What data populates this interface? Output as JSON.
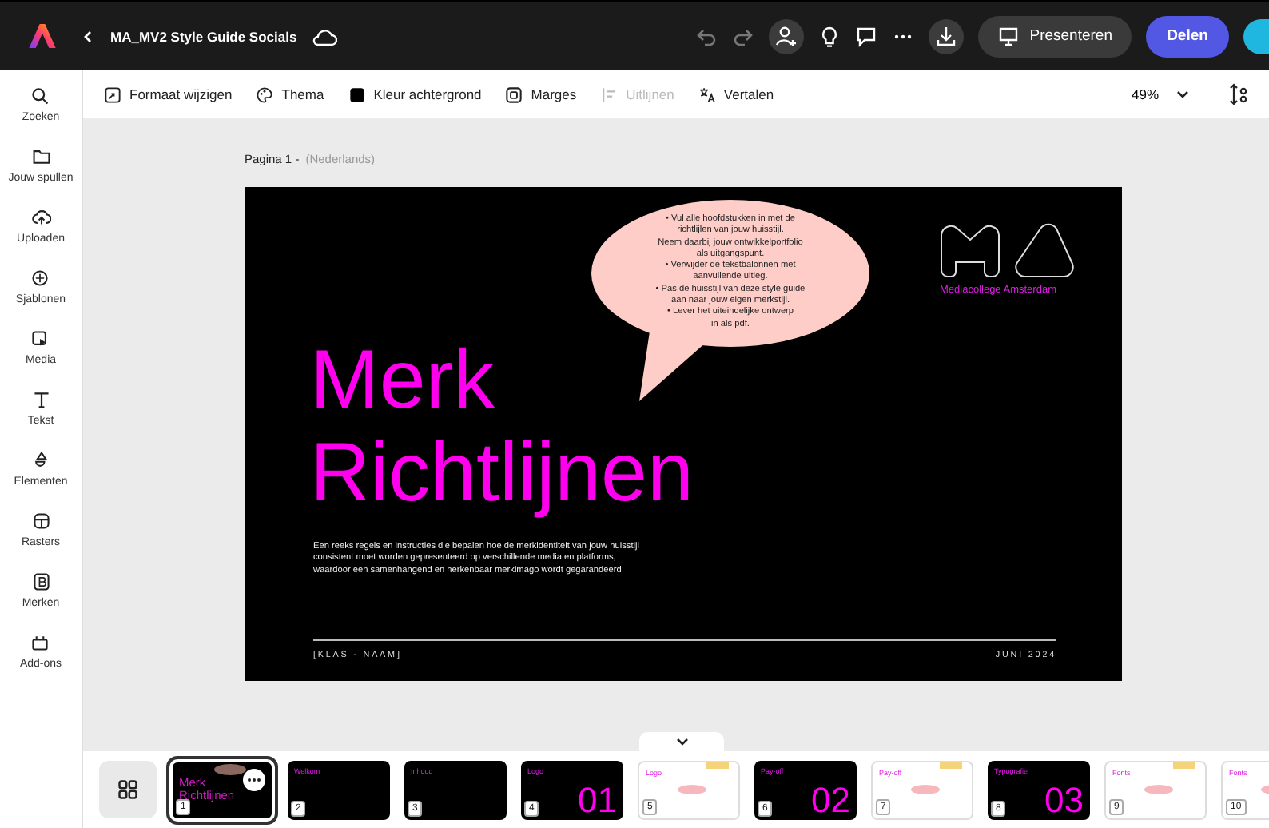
{
  "topbar": {
    "title": "MA_MV2 Style Guide Socials",
    "present_button": "Presenteren",
    "share_button": "Delen"
  },
  "toolbar": {
    "items": [
      {
        "label": "Formaat wijzigen",
        "kind": "resize",
        "disabled": false
      },
      {
        "label": "Thema",
        "kind": "palette",
        "disabled": false
      },
      {
        "label": "Kleur achtergrond",
        "kind": "swatch",
        "disabled": false
      },
      {
        "label": "Marges",
        "kind": "margins",
        "disabled": false
      },
      {
        "label": "Uitlijnen",
        "kind": "align",
        "disabled": true
      },
      {
        "label": "Vertalen",
        "kind": "translate",
        "disabled": false
      }
    ],
    "zoom": "49%"
  },
  "sidebar": {
    "items": [
      {
        "label": "Zoeken",
        "kind": "search"
      },
      {
        "label": "Jouw spullen",
        "kind": "folder"
      },
      {
        "label": "Uploaden",
        "kind": "upload"
      },
      {
        "label": "Sjablonen",
        "kind": "templates"
      },
      {
        "label": "Media",
        "kind": "media"
      },
      {
        "label": "Tekst",
        "kind": "text"
      },
      {
        "label": "Elementen",
        "kind": "shapes"
      },
      {
        "label": "Rasters",
        "kind": "grid"
      },
      {
        "label": "Merken",
        "kind": "brand"
      },
      {
        "label": "Add-ons",
        "kind": "addons"
      }
    ]
  },
  "page": {
    "label": "Pagina 1 -",
    "language": "(Nederlands)"
  },
  "slide": {
    "title_lines": [
      "Merk",
      "Richtlijnen"
    ],
    "bubble_text": "• Vul alle hoofdstukken in met de\nrichtlijlen van jouw huisstijl.\nNeem daarbij jouw ontwikkelportfolio\nals uitgangspunt.\n• Verwijder de tekstbalonnen met\naanvullende uitleg.\n• Pas de huisstijl van deze style guide\naan naar jouw eigen merkstijl.\n• Lever het uiteindelijke ontwerp\nin als pdf.",
    "logo_caption": "Mediacollege Amsterdam",
    "description": "Een reeks regels en instructies die bepalen hoe de merkidentiteit van jouw huisstijl\nconsistent moet worden gepresenteerd op verschillende media en platforms,\nwaardoor een samenhangend en herkenbaar merkimago wordt gegarandeerd",
    "footer_left": "[KLAS - NAAM]",
    "footer_right": "JUNI 2024"
  },
  "thumbnails": [
    {
      "number": "1",
      "title": "Merk Richtlijnen",
      "dark": true,
      "selected": true
    },
    {
      "number": "2",
      "title": "Welkom",
      "dark": true,
      "selected": false
    },
    {
      "number": "3",
      "title": "Inhoud",
      "dark": true,
      "selected": false
    },
    {
      "number": "4",
      "title": "Logo",
      "dark": true,
      "big_number": "01",
      "selected": false
    },
    {
      "number": "5",
      "title": "Logo",
      "dark": false,
      "selected": false
    },
    {
      "number": "6",
      "title": "Pay-off",
      "dark": true,
      "big_number": "02",
      "selected": false
    },
    {
      "number": "7",
      "title": "Pay-off",
      "dark": false,
      "selected": false
    },
    {
      "number": "8",
      "title": "Typografie",
      "dark": true,
      "big_number": "03",
      "selected": false
    },
    {
      "number": "9",
      "title": "Fonts",
      "dark": false,
      "selected": false
    },
    {
      "number": "10",
      "title": "Fonts",
      "dark": false,
      "selected": false
    }
  ]
}
